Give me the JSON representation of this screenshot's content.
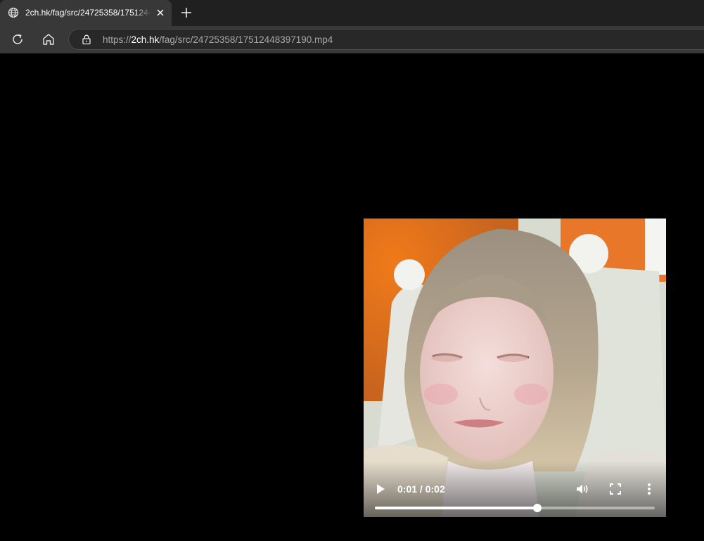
{
  "tab": {
    "title": "2ch.hk/fag/src/24725358/17512448397190.mp4",
    "favicon": "globe-icon",
    "close_icon": "close-icon",
    "new_tab_icon": "plus-icon"
  },
  "toolbar": {
    "reload_icon": "reload-icon",
    "home_icon": "home-icon",
    "site_info_icon": "lock-icon"
  },
  "address": {
    "scheme": "https://",
    "host": "2ch.hk",
    "path": "/fag/src/24725358/17512448397190.mp4"
  },
  "video": {
    "current_time": "0:01",
    "separator": " / ",
    "duration": "0:02",
    "progress_fraction": 0.58,
    "play_icon": "play-icon",
    "volume_icon": "volume-icon",
    "fullscreen_icon": "fullscreen-icon",
    "menu_icon": "more-vertical-icon"
  },
  "colors": {
    "tab_strip": "#202020",
    "active_tab": "#383838",
    "omnibox": "#282828",
    "page_background": "#000000"
  }
}
